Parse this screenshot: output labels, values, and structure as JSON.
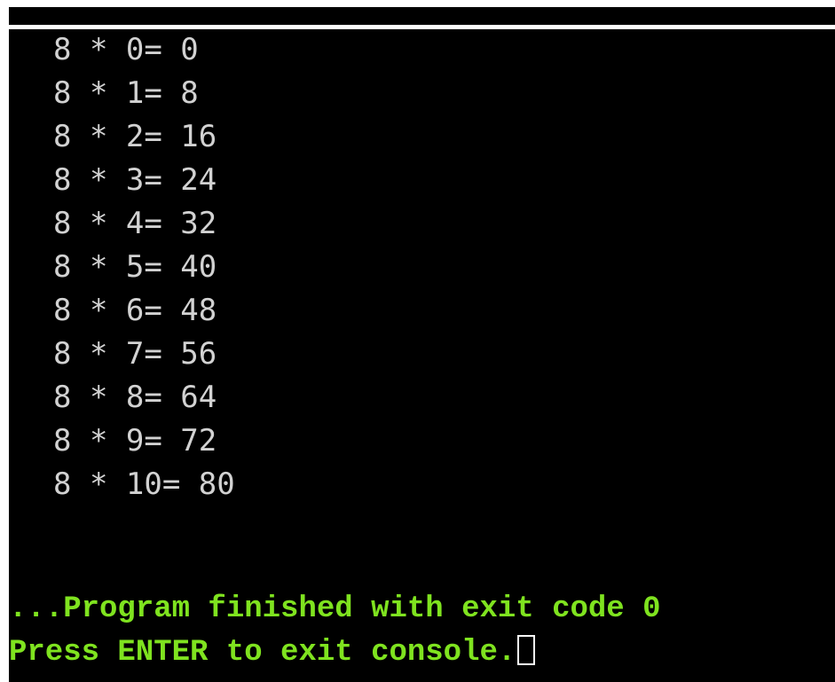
{
  "console": {
    "output_lines": [
      "8 * 0= 0",
      "8 * 1= 8",
      "8 * 2= 16",
      "8 * 3= 24",
      "8 * 4= 32",
      "8 * 5= 40",
      "8 * 6= 48",
      "8 * 7= 56",
      "8 * 8= 64",
      "8 * 9= 72",
      "8 * 10= 80"
    ],
    "finished_message": "...Program finished with exit code 0",
    "exit_prompt": "Press ENTER to exit console."
  },
  "colors": {
    "background": "#000000",
    "output_text": "#d2d2d2",
    "status_text": "#7fe31f"
  }
}
